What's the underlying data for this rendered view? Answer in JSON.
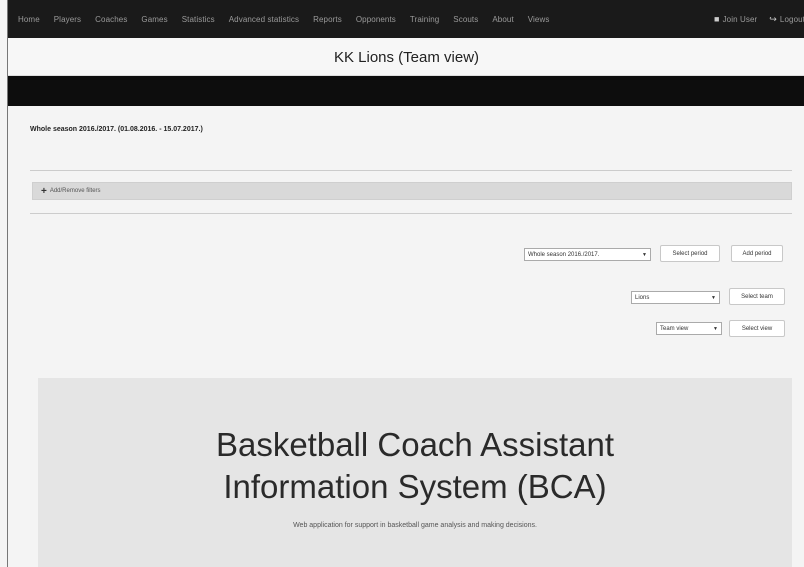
{
  "nav": {
    "items": [
      "Home",
      "Players",
      "Coaches",
      "Games",
      "Statistics",
      "Advanced statistics",
      "Reports",
      "Opponents",
      "Training",
      "Scouts",
      "About",
      "Views"
    ],
    "user": "Join User",
    "logout": "Logout"
  },
  "header": {
    "title": "KK Lions (Team view)"
  },
  "season": {
    "text": "Whole season 2016./2017. (01.08.2016. - 15.07.2017.)"
  },
  "filters": {
    "label": "Add/Remove filters"
  },
  "controls": {
    "period_select": "Whole season 2016./2017.",
    "select_period": "Select period",
    "add_period": "Add period",
    "team_select": "Lions",
    "select_team": "Select team",
    "view_select": "Team view",
    "select_view": "Select view"
  },
  "hero": {
    "title_line1": "Basketball Coach Assistant",
    "title_line2": "Information System (BCA)",
    "subtitle": "Web application for support in basketball game analysis and making decisions."
  }
}
